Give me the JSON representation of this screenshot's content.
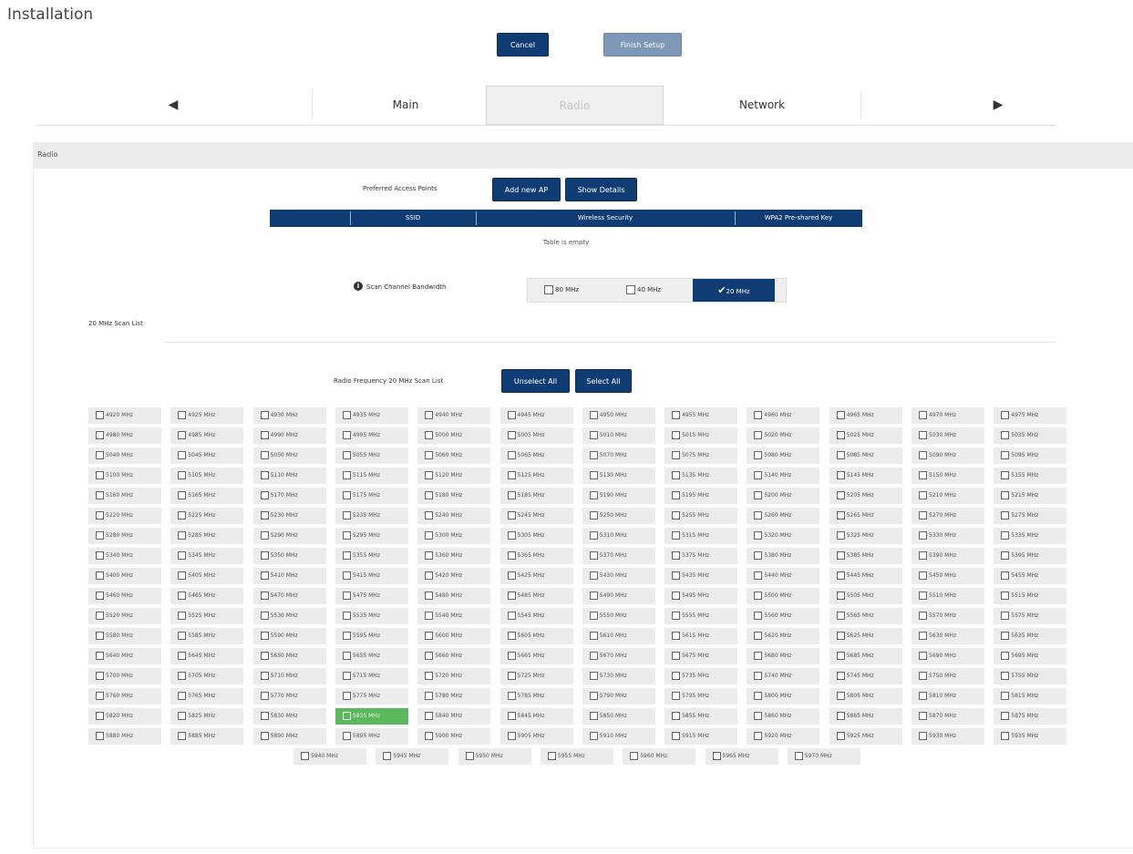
{
  "page": {
    "title": "Installation"
  },
  "buttons": {
    "cancel": "Cancel",
    "finish": "Finish Setup"
  },
  "nav": {
    "prev_icon": "arrow-left-icon",
    "next_icon": "arrow-right-icon",
    "tabs": [
      "Main",
      "Radio",
      "Network"
    ]
  },
  "radio_panel": {
    "heading": "Radio",
    "ap_label": "Preferred Access Points",
    "add_ap": "Add new AP",
    "show_details": "Show Details",
    "columns": [
      "SSID",
      "Wireless Security",
      "WPA2 Pre-shared Key"
    ],
    "empty_text": "Table is empty",
    "bw_label": "Scan Channel Bandwidth",
    "bw_options": [
      {
        "label": "80 MHz",
        "checked": false
      },
      {
        "label": "40 MHz",
        "checked": false
      },
      {
        "label": "20 MHz",
        "checked": true
      }
    ],
    "scan_list_label": "20 MHz Scan List",
    "freq_label": "Radio Frequency 20 MHz Scan List",
    "unselect_all": "Unselect All",
    "select_all": "Select All",
    "highlight_color": "#5cb85c",
    "accent_color": "#0f3d73"
  },
  "frequencies": {
    "rows": [
      [
        "4920 MHz",
        "4925 MHz",
        "4930 MHz",
        "4935 MHz",
        "4940 MHz",
        "4945 MHz",
        "4950 MHz",
        "4955 MHz",
        "4960 MHz",
        "4965 MHz",
        "4970 MHz",
        "4975 MHz"
      ],
      [
        "4980 MHz",
        "4985 MHz",
        "4990 MHz",
        "4995 MHz",
        "5000 MHz",
        "5005 MHz",
        "5010 MHz",
        "5015 MHz",
        "5020 MHz",
        "5025 MHz",
        "5030 MHz",
        "5035 MHz"
      ],
      [
        "5040 MHz",
        "5045 MHz",
        "5050 MHz",
        "5055 MHz",
        "5060 MHz",
        "5065 MHz",
        "5070 MHz",
        "5075 MHz",
        "5080 MHz",
        "5085 MHz",
        "5090 MHz",
        "5095 MHz"
      ],
      [
        "5100 MHz",
        "5105 MHz",
        "5110 MHz",
        "5115 MHz",
        "5120 MHz",
        "5125 MHz",
        "5130 MHz",
        "5135 MHz",
        "5140 MHz",
        "5145 MHz",
        "5150 MHz",
        "5155 MHz"
      ],
      [
        "5160 MHz",
        "5165 MHz",
        "5170 MHz",
        "5175 MHz",
        "5180 MHz",
        "5185 MHz",
        "5190 MHz",
        "5195 MHz",
        "5200 MHz",
        "5205 MHz",
        "5210 MHz",
        "5215 MHz"
      ],
      [
        "5220 MHz",
        "5225 MHz",
        "5230 MHz",
        "5235 MHz",
        "5240 MHz",
        "5245 MHz",
        "5250 MHz",
        "5255 MHz",
        "5260 MHz",
        "5265 MHz",
        "5270 MHz",
        "5275 MHz"
      ],
      [
        "5280 MHz",
        "5285 MHz",
        "5290 MHz",
        "5295 MHz",
        "5300 MHz",
        "5305 MHz",
        "5310 MHz",
        "5315 MHz",
        "5320 MHz",
        "5325 MHz",
        "5330 MHz",
        "5335 MHz"
      ],
      [
        "5340 MHz",
        "5345 MHz",
        "5350 MHz",
        "5355 MHz",
        "5360 MHz",
        "5365 MHz",
        "5370 MHz",
        "5375 MHz",
        "5380 MHz",
        "5385 MHz",
        "5390 MHz",
        "5395 MHz"
      ],
      [
        "5400 MHz",
        "5405 MHz",
        "5410 MHz",
        "5415 MHz",
        "5420 MHz",
        "5425 MHz",
        "5430 MHz",
        "5435 MHz",
        "5440 MHz",
        "5445 MHz",
        "5450 MHz",
        "5455 MHz"
      ],
      [
        "5460 MHz",
        "5465 MHz",
        "5470 MHz",
        "5475 MHz",
        "5480 MHz",
        "5485 MHz",
        "5490 MHz",
        "5495 MHz",
        "5500 MHz",
        "5505 MHz",
        "5510 MHz",
        "5515 MHz"
      ],
      [
        "5520 MHz",
        "5525 MHz",
        "5530 MHz",
        "5535 MHz",
        "5540 MHz",
        "5545 MHz",
        "5550 MHz",
        "5555 MHz",
        "5560 MHz",
        "5565 MHz",
        "5570 MHz",
        "5575 MHz"
      ],
      [
        "5580 MHz",
        "5585 MHz",
        "5590 MHz",
        "5595 MHz",
        "5600 MHz",
        "5605 MHz",
        "5610 MHz",
        "5615 MHz",
        "5620 MHz",
        "5625 MHz",
        "5630 MHz",
        "5635 MHz"
      ],
      [
        "5640 MHz",
        "5645 MHz",
        "5650 MHz",
        "5655 MHz",
        "5660 MHz",
        "5665 MHz",
        "5670 MHz",
        "5675 MHz",
        "5680 MHz",
        "5685 MHz",
        "5690 MHz",
        "5695 MHz"
      ],
      [
        "5700 MHz",
        "5705 MHz",
        "5710 MHz",
        "5715 MHz",
        "5720 MHz",
        "5725 MHz",
        "5730 MHz",
        "5735 MHz",
        "5740 MHz",
        "5745 MHz",
        "5750 MHz",
        "5755 MHz"
      ],
      [
        "5760 MHz",
        "5765 MHz",
        "5770 MHz",
        "5775 MHz",
        "5780 MHz",
        "5785 MHz",
        "5790 MHz",
        "5795 MHz",
        "5800 MHz",
        "5805 MHz",
        "5810 MHz",
        "5815 MHz"
      ],
      [
        "5820 MHz",
        "5825 MHz",
        "5830 MHz",
        "5835 MHz",
        "5840 MHz",
        "5845 MHz",
        "5850 MHz",
        "5855 MHz",
        "5860 MHz",
        "5865 MHz",
        "5870 MHz",
        "5875 MHz"
      ],
      [
        "5880 MHz",
        "5885 MHz",
        "5890 MHz",
        "5895 MHz",
        "5900 MHz",
        "5905 MHz",
        "5910 MHz",
        "5915 MHz",
        "5920 MHz",
        "5925 MHz",
        "5930 MHz",
        "5935 MHz"
      ]
    ],
    "last_row": [
      "5940 MHz",
      "5945 MHz",
      "5950 MHz",
      "5955 MHz",
      "5960 MHz",
      "5965 MHz",
      "5970 MHz"
    ],
    "highlighted": "5835 MHz"
  }
}
